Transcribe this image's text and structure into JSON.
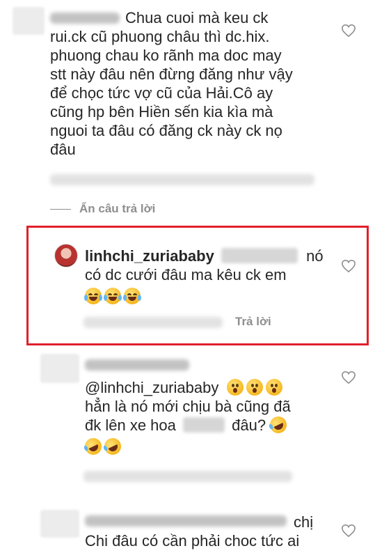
{
  "comments": [
    {
      "text_lines": [
        "Chua cuoi mà keu ck",
        "rui.ck cũ phuong châu thì dc.hix.",
        "phuong chau ko rãnh ma doc may",
        "stt này đâu nên đừng đăng như vậy",
        "để chọc tức vợ cũ của Hải.Cô ay",
        "cũng hp bên Hiền sến kia kìa mà",
        "nguoi ta đâu có đăng ck này ck nọ",
        "đâu"
      ]
    },
    {
      "username": "linhchi_zuriababy",
      "line1_tail": "nó",
      "line2": "có dc cưới đâu ma kêu ck em",
      "emojis": [
        "face-with-tears-of-joy",
        "face-with-tears-of-joy",
        "face-with-tears-of-joy"
      ],
      "reply_label": "Trả lời"
    },
    {
      "mention": "@linhchi_zuriababy",
      "line2": "hẳn là nó mới chịu bà cũng đã",
      "line3_a": "đk lên xe hoa",
      "line3_b": "đâu?",
      "emojis_line1": [
        "hushed-face",
        "hushed-face",
        "hushed-face"
      ],
      "emojis_line4": [
        "rolling-on-floor-laughing",
        "rolling-on-floor-laughing"
      ]
    },
    {
      "tail_word": "chị",
      "line2": "Chi đâu có cần phải choc tức ai"
    }
  ],
  "hide_replies_label": "Ẩn câu trả lời",
  "colors": {
    "text": "#262626",
    "muted": "#8e8e8e",
    "highlight_border": "#e0202b"
  },
  "icons": [
    "heart-icon",
    "avatar"
  ]
}
